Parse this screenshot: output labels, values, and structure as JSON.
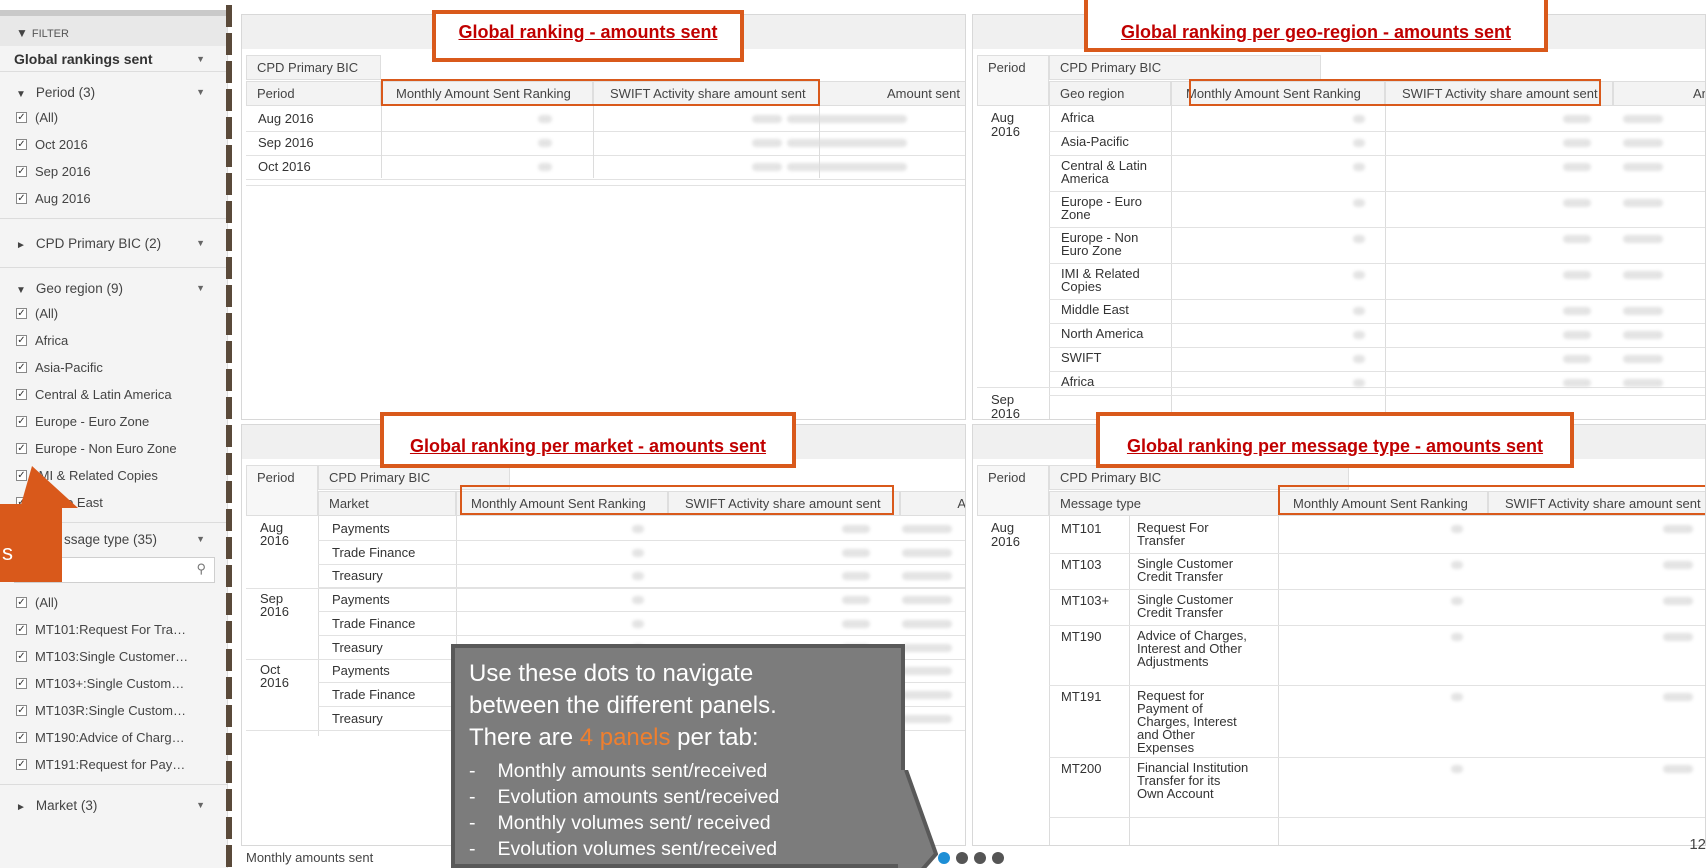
{
  "filter": {
    "header": "FILTER",
    "selector": "Global rankings sent",
    "period": {
      "title": "Period (3)",
      "items": [
        "(All)",
        "Oct 2016",
        "Sep 2016",
        "Aug 2016"
      ]
    },
    "cpd": {
      "title": "CPD Primary BIC (2)"
    },
    "geo": {
      "title": "Geo region (9)",
      "items": [
        "(All)",
        "Africa",
        "Asia-Pacific",
        "Central & Latin America",
        "Europe - Euro Zone",
        "Europe - Non Euro Zone",
        "IMI & Related Copies",
        "Middle East"
      ]
    },
    "msg": {
      "title": "ssage type (35)",
      "items": [
        "(All)",
        "MT101:Request For Tra…",
        "MT103:Single Customer…",
        "MT103+:Single Custom…",
        "MT103R:Single Custom…",
        "MT190:Advice of Charg…",
        "MT191:Request for Pay…"
      ]
    },
    "market": {
      "title": "Market (3)"
    },
    "callout_letter": "s"
  },
  "panel1": {
    "title": "Global ranking - amounts sent",
    "h_cpd": "CPD Primary BIC",
    "h_period": "Period",
    "h_rank": "Monthly Amount Sent Ranking",
    "h_share": "SWIFT Activity share amount sent",
    "h_amount": "Amount sent",
    "rows": [
      "Aug 2016",
      "Sep 2016",
      "Oct 2016"
    ]
  },
  "panel2": {
    "title": "Global ranking per geo-region - amounts sent",
    "h_period": "Period",
    "h_cpd": "CPD Primary BIC",
    "h_geo": "Geo region",
    "h_rank": "Monthly Amount Sent Ranking",
    "h_share": "SWIFT Activity share amount sent",
    "h_amount": "Ar",
    "period_aug": "Aug 2016",
    "period_sep": "Sep 2016",
    "regions": [
      "Africa",
      "Asia-Pacific",
      "Central & Latin America",
      "Europe - Euro Zone",
      "Europe - Non Euro Zone",
      "IMI & Related Copies",
      "Middle East",
      "North America",
      "SWIFT",
      "Africa"
    ]
  },
  "panel3": {
    "title": "Global ranking per market - amounts sent",
    "h_period": "Period",
    "h_cpd": "CPD Primary BIC",
    "h_market": "Market",
    "h_rank": "Monthly Amount Sent Ranking",
    "h_share": "SWIFT Activity share amount sent",
    "h_a": "A",
    "periods": [
      "Aug 2016",
      "Sep 2016",
      "Oct 2016"
    ],
    "markets": [
      "Payments",
      "Trade Finance",
      "Treasury",
      "Payments",
      "Trade Finance",
      "Treasury",
      "Payments",
      "Trade Finance",
      "Treasury"
    ]
  },
  "panel4": {
    "title": "Global ranking per message type - amounts sent",
    "h_period": "Period",
    "h_cpd": "CPD Primary BIC",
    "h_msg": "Message type",
    "h_rank": "Monthly Amount Sent Ranking",
    "h_share": "SWIFT Activity share amount sent",
    "period": "Aug 2016",
    "codes": [
      "MT101",
      "MT103",
      "MT103+",
      "MT190",
      "MT191",
      "MT200"
    ],
    "descs": [
      "Request For Transfer",
      "Single Customer Credit Transfer",
      "Single Customer Credit Transfer",
      "Advice of Charges, Interest and Other Adjustments",
      "Request for Payment of Charges, Interest and Other Expenses",
      "Financial Institution Transfer for its Own Account"
    ]
  },
  "tooltip": {
    "line1": "Use these dots to navigate",
    "line2": "between the different panels.",
    "line3a": "There are ",
    "line3b": "4 panels",
    "line3c": " per tab:",
    "bullets": [
      "Monthly amounts sent/received",
      "Evolution amounts sent/received",
      "Monthly volumes sent/ received",
      "Evolution volumes sent/received"
    ]
  },
  "footer": "Monthly amounts sent",
  "page_number": "12",
  "colors": {
    "accent": "#d9591b",
    "title_red": "#c00000",
    "dot_active": "#1e8fd6"
  }
}
